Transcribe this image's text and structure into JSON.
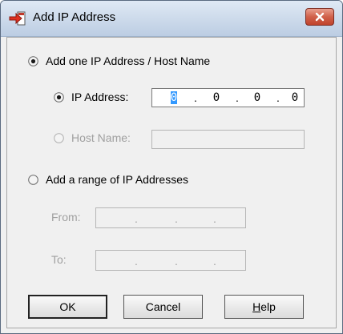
{
  "window": {
    "title": "Add IP Address",
    "close_glyph": "✕"
  },
  "options": {
    "single": {
      "label": "Add one IP Address / Host Name",
      "selected": true
    },
    "ip_address": {
      "label": "IP Address:",
      "selected": true,
      "octets": [
        "0",
        "0",
        "0",
        "0"
      ]
    },
    "host_name": {
      "label": "Host Name:",
      "selected": false,
      "value": ""
    },
    "range": {
      "label": "Add a range of IP Addresses",
      "selected": false
    },
    "from": {
      "label": "From:"
    },
    "to": {
      "label": "To:"
    }
  },
  "buttons": {
    "ok": "OK",
    "cancel": "Cancel",
    "help_mnemonic": "H",
    "help_rest": "elp"
  },
  "icons": {
    "app": "add-ip-arrow-icon",
    "close": "close-icon"
  },
  "colors": {
    "close_button": "#c1442c",
    "selection": "#3399ff",
    "dialog_bg": "#f0f0f0"
  }
}
